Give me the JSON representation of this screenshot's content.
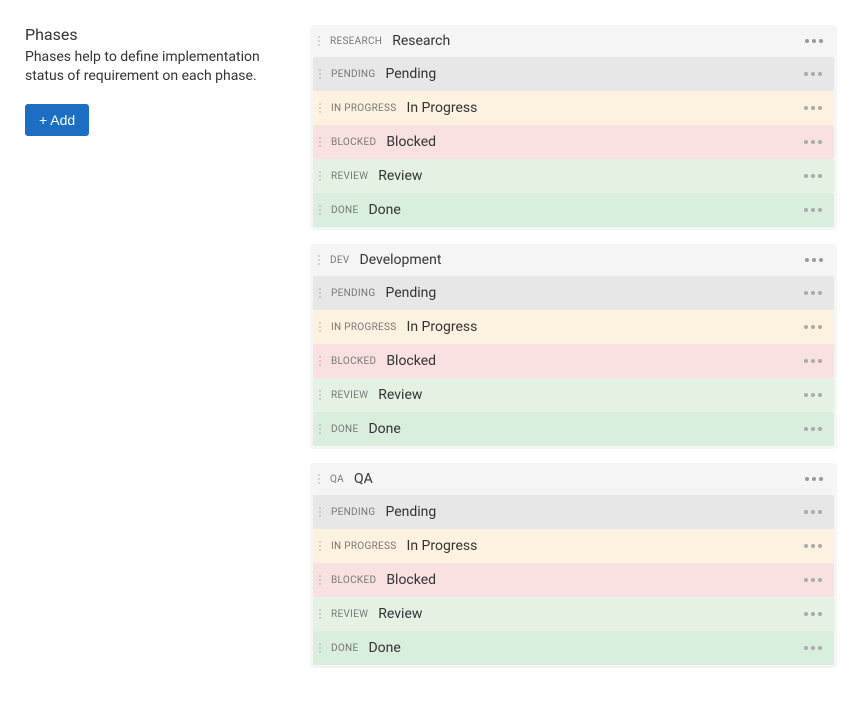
{
  "sidebar": {
    "title": "Phases",
    "description": "Phases help to define implementation status of requirement on each phase.",
    "add_button": "+ Add"
  },
  "groups": [
    {
      "tag": "RESEARCH",
      "name": "Research",
      "statuses": [
        {
          "tag": "PENDING",
          "name": "Pending",
          "class": "status-pending"
        },
        {
          "tag": "IN PROGRESS",
          "name": "In Progress",
          "class": "status-inprogress"
        },
        {
          "tag": "BLOCKED",
          "name": "Blocked",
          "class": "status-blocked"
        },
        {
          "tag": "REVIEW",
          "name": "Review",
          "class": "status-review"
        },
        {
          "tag": "DONE",
          "name": "Done",
          "class": "status-done"
        }
      ]
    },
    {
      "tag": "DEV",
      "name": "Development",
      "statuses": [
        {
          "tag": "PENDING",
          "name": "Pending",
          "class": "status-pending"
        },
        {
          "tag": "IN PROGRESS",
          "name": "In Progress",
          "class": "status-inprogress"
        },
        {
          "tag": "BLOCKED",
          "name": "Blocked",
          "class": "status-blocked"
        },
        {
          "tag": "REVIEW",
          "name": "Review",
          "class": "status-review"
        },
        {
          "tag": "DONE",
          "name": "Done",
          "class": "status-done"
        }
      ]
    },
    {
      "tag": "QA",
      "name": "QA",
      "statuses": [
        {
          "tag": "PENDING",
          "name": "Pending",
          "class": "status-pending"
        },
        {
          "tag": "IN PROGRESS",
          "name": "In Progress",
          "class": "status-inprogress"
        },
        {
          "tag": "BLOCKED",
          "name": "Blocked",
          "class": "status-blocked"
        },
        {
          "tag": "REVIEW",
          "name": "Review",
          "class": "status-review"
        },
        {
          "tag": "DONE",
          "name": "Done",
          "class": "status-done"
        }
      ]
    }
  ]
}
